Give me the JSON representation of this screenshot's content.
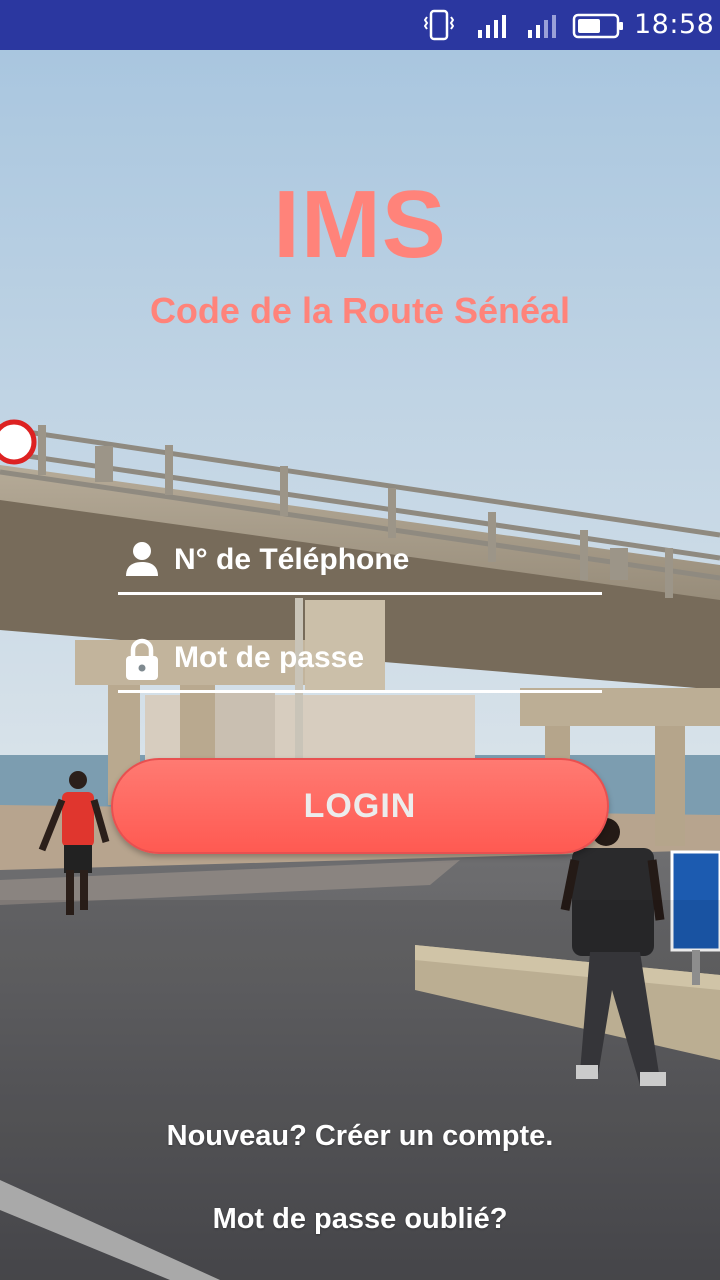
{
  "status_bar": {
    "time": "18:58",
    "icons": [
      "vibrate-icon",
      "signal-icon",
      "signal-icon",
      "battery-icon"
    ]
  },
  "branding": {
    "title": "IMS",
    "subtitle": "Code de la Route Sénéal",
    "color": "#ff837a"
  },
  "form": {
    "phone_placeholder": "N° de Téléphone",
    "phone_value": "",
    "phone_icon": "person-icon",
    "password_placeholder": "Mot de passe",
    "password_value": "",
    "password_icon": "lock-icon",
    "login_label": "LOGIN",
    "button_color": "#ff6158"
  },
  "links": {
    "create_account": "Nouveau? Créer un compte.",
    "forgot_password": "Mot de passe oublié?"
  },
  "colors": {
    "status_bar": "#2b37a0",
    "text_light": "#ffffff"
  }
}
